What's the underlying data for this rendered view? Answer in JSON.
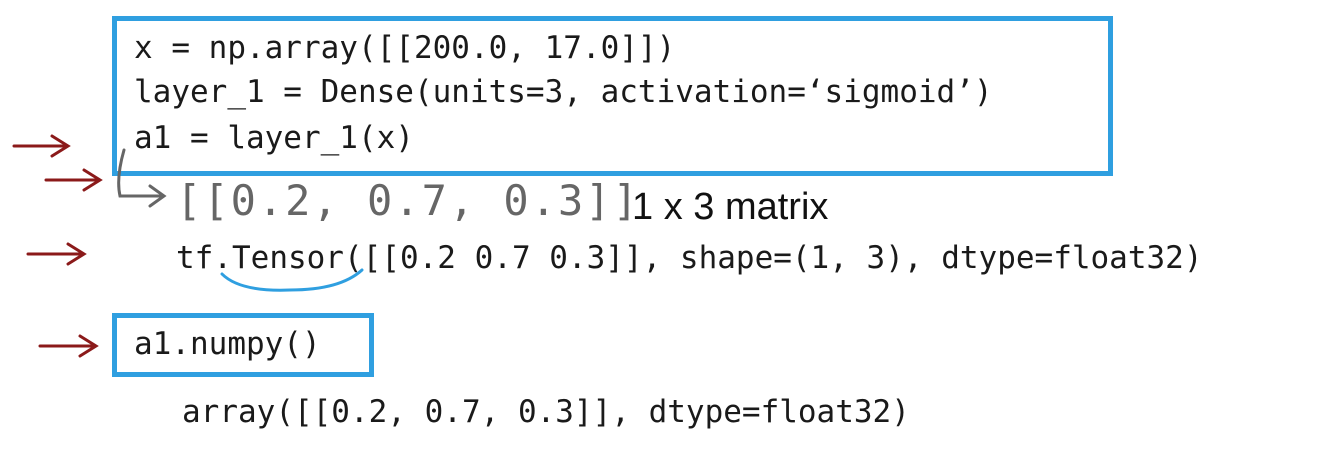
{
  "code": {
    "line1": "x = np.array([[200.0, 17.0]])",
    "line2": "layer_1 = Dense(units=3, activation=‘sigmoid’)",
    "line3": "a1 = layer_1(x)"
  },
  "annotation": {
    "handwritten": "[[0.2, 0.7, 0.3]]",
    "matrix_label": "1 x 3 matrix"
  },
  "tensor_output": "tf.Tensor([[0.2 0.7 0.3]], shape=(1, 3), dtype=float32)",
  "numpy_call": "a1.numpy()",
  "numpy_result": "array([[0.2, 0.7, 0.3]], dtype=float32)",
  "colors": {
    "box_border": "#2f9fe0",
    "arrow": "#8b1a1a",
    "underline": "#2f9fe0"
  }
}
